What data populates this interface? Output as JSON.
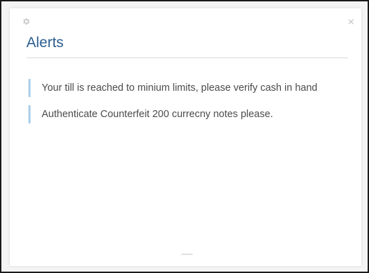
{
  "widget": {
    "title": "Alerts",
    "settings_icon": "gear-icon",
    "close_icon": "close-icon",
    "close_glyph": "×",
    "alerts": [
      {
        "text": "Your till is reached to minium limits, please verify cash in hand"
      },
      {
        "text": "Authenticate Counterfeit 200 currecny notes please."
      }
    ]
  },
  "colors": {
    "title": "#2b5c8f",
    "alert_accent": "#a9cdea",
    "alert_text": "#4a4a4a",
    "frame_border": "#1a1a1a"
  }
}
